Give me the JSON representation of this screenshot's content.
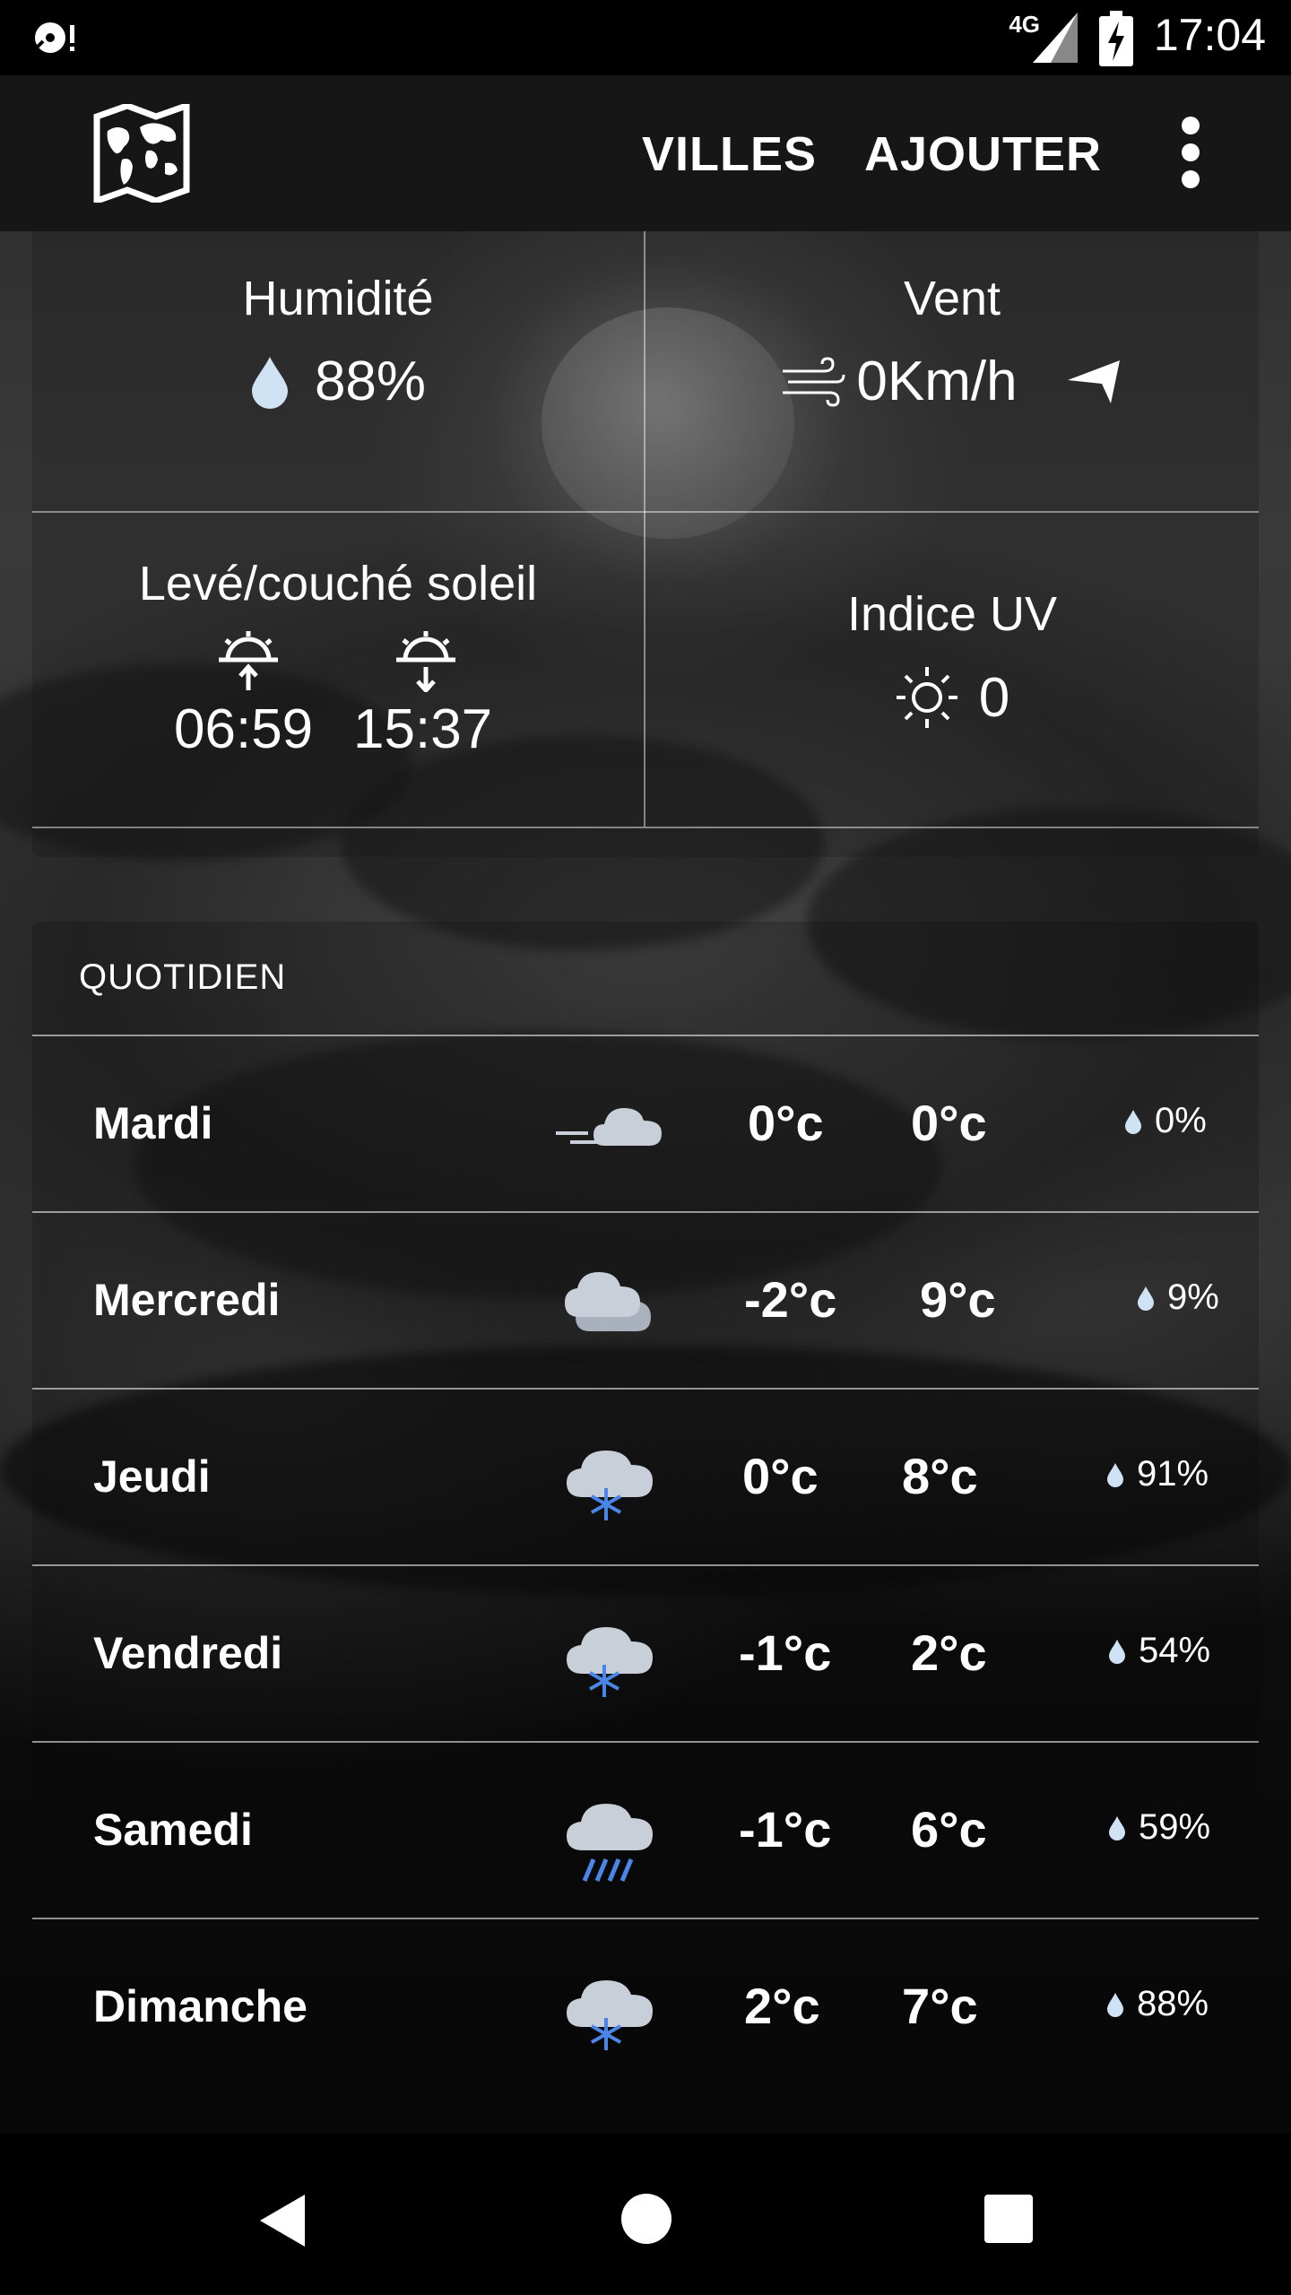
{
  "status_bar": {
    "network": "4G",
    "time": "17:04"
  },
  "app_bar": {
    "cities_label": "VILLES",
    "add_label": "AJOUTER"
  },
  "details": {
    "humidity": {
      "title": "Humidité",
      "value": "88%"
    },
    "wind": {
      "title": "Vent",
      "value": "0Km/h"
    },
    "sun": {
      "title": "Levé/couché soleil",
      "sunrise": "06:59",
      "sunset": "15:37"
    },
    "uv": {
      "title": "Indice UV",
      "value": "0"
    }
  },
  "daily": {
    "header": "QUOTIDIEN",
    "days": [
      {
        "day": "Mardi",
        "icon": "wind-cloud-icon",
        "min": "0°c",
        "max": "0°c",
        "precip": "0%"
      },
      {
        "day": "Mercredi",
        "icon": "cloudy-icon",
        "min": "-2°c",
        "max": "9°c",
        "precip": "9%"
      },
      {
        "day": "Jeudi",
        "icon": "snow-cloud-icon",
        "min": "0°c",
        "max": "8°c",
        "precip": "91%"
      },
      {
        "day": "Vendredi",
        "icon": "snow-cloud-icon",
        "min": "-1°c",
        "max": "2°c",
        "precip": "54%"
      },
      {
        "day": "Samedi",
        "icon": "rain-cloud-icon",
        "min": "-1°c",
        "max": "6°c",
        "precip": "59%"
      },
      {
        "day": "Dimanche",
        "icon": "snow-cloud-icon",
        "min": "2°c",
        "max": "7°c",
        "precip": "88%"
      }
    ]
  },
  "colors": {
    "accent_blue": "#4a86e8",
    "cloud": "#c9cfd8",
    "cloud_shadow": "#a9b1bd"
  }
}
